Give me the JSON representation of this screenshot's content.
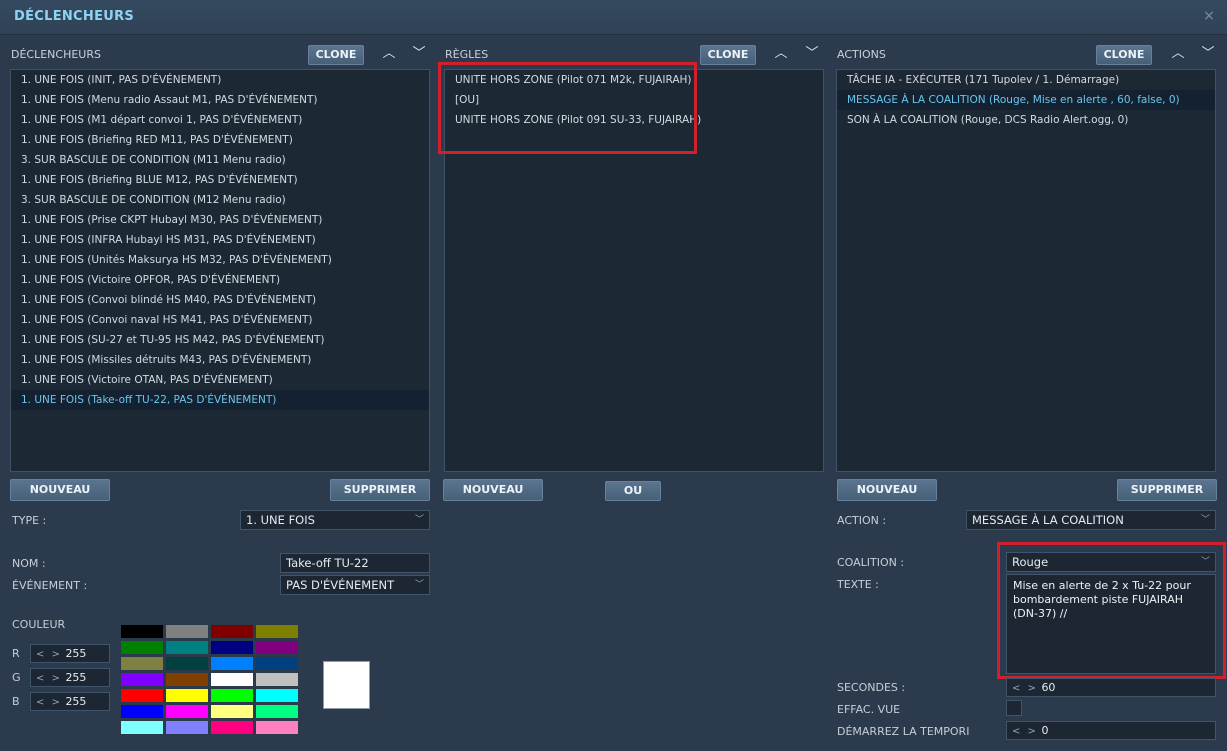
{
  "window": {
    "title": "DÉCLENCHEURS",
    "close_glyph": "×"
  },
  "buttons": {
    "clone": "CLONE",
    "nouveau": "NOUVEAU",
    "supprimer": "SUPPRIMER",
    "ou": "OU",
    "up_glyph": "︿",
    "down_glyph": "﹀"
  },
  "triggers": {
    "header": "DÉCLENCHEURS",
    "items": [
      "1. UNE FOIS (INIT, PAS D'ÉVÉNEMENT)",
      "1. UNE FOIS (Menu radio Assaut M1, PAS D'ÉVÉNEMENT)",
      "1. UNE FOIS (M1 départ convoi 1, PAS D'ÉVÉNEMENT)",
      "1. UNE FOIS (Briefing RED M11, PAS D'ÉVÉNEMENT)",
      "3. SUR BASCULE DE CONDITION (M11 Menu radio)",
      "1. UNE FOIS (Briefing BLUE M12, PAS D'ÉVÉNEMENT)",
      "3. SUR BASCULE DE CONDITION (M12 Menu radio)",
      "1. UNE FOIS (Prise CKPT Hubayl M30, PAS D'ÉVÉNEMENT)",
      "1. UNE FOIS (INFRA Hubayl HS M31, PAS D'ÉVÉNEMENT)",
      "1. UNE FOIS (Unités Maksurya HS M32, PAS D'ÉVÉNEMENT)",
      "1. UNE FOIS (Victoire OPFOR, PAS D'ÉVÉNEMENT)",
      "1. UNE FOIS (Convoi blindé HS M40, PAS D'ÉVÉNEMENT)",
      "1. UNE FOIS (Convoi naval HS M41, PAS D'ÉVÉNEMENT)",
      "1. UNE FOIS (SU-27 et TU-95 HS M42, PAS D'ÉVÉNEMENT)",
      "1. UNE FOIS (Missiles détruits M43, PAS D'ÉVÉNEMENT)",
      "1. UNE FOIS (Victoire OTAN, PAS D'ÉVÉNEMENT)",
      "1. UNE FOIS (Take-off TU-22, PAS D'ÉVÉNEMENT)"
    ],
    "selected_index": 16
  },
  "rules": {
    "header": "RÈGLES",
    "items": [
      "UNITE HORS ZONE (Pilot 071 M2k, FUJAIRAH)",
      "[OU]",
      "UNITE HORS ZONE (Pilot 091 SU-33, FUJAIRAH)"
    ]
  },
  "actions": {
    "header": "ACTIONS",
    "items": [
      "TÂCHE IA - EXÉCUTER (171 Tupolev / 1. Démarrage)",
      "MESSAGE À LA COALITION (Rouge, Mise en alerte , 60, false, 0)",
      "SON À LA COALITION (Rouge, DCS Radio Alert.ogg, 0)"
    ],
    "selected_index": 1
  },
  "trigger_props": {
    "type_label": "TYPE :",
    "type_value": "1. UNE FOIS",
    "name_label": "NOM :",
    "name_value": "Take-off TU-22",
    "event_label": "ÉVÉNEMENT :",
    "event_value": "PAS D'ÉVÉNEMENT",
    "color_label": "COULEUR",
    "r_label": "R",
    "r_value": "255",
    "g_label": "G",
    "g_value": "255",
    "b_label": "B",
    "b_value": "255",
    "preview_color": "#ffffff",
    "palette": [
      "#000000",
      "#808080",
      "#800000",
      "#808000",
      "#008000",
      "#008080",
      "#000080",
      "#800080",
      "#808040",
      "#004040",
      "#0080ff",
      "#004080",
      "#8000ff",
      "#804000",
      "#ffffff",
      "#c0c0c0",
      "#ff0000",
      "#ffff00",
      "#00ff00",
      "#00ffff",
      "#0000ff",
      "#ff00ff",
      "#ffff80",
      "#00ff80",
      "#80ffff",
      "#8080ff",
      "#ff0080",
      "#ff80c0"
    ]
  },
  "action_props": {
    "action_label": "ACTION :",
    "action_value": "MESSAGE À LA COALITION",
    "coalition_label": "COALITION :",
    "coalition_value": "Rouge",
    "text_label": "TEXTE :",
    "text_value": "Mise en alerte de 2 x Tu-22 pour bombardement piste FUJAIRAH (DN-37) //",
    "seconds_label": "SECONDES :",
    "seconds_value": "60",
    "clear_view_label": "EFFAC. VUE",
    "start_delay_label": "DÉMARREZ LA TEMPORI",
    "start_delay_value": "0",
    "spin_glyph": "< >"
  },
  "colors": {
    "highlight": "#d0202c",
    "selected_text": "#6cc5ec",
    "title_text": "#8fd3f2"
  }
}
